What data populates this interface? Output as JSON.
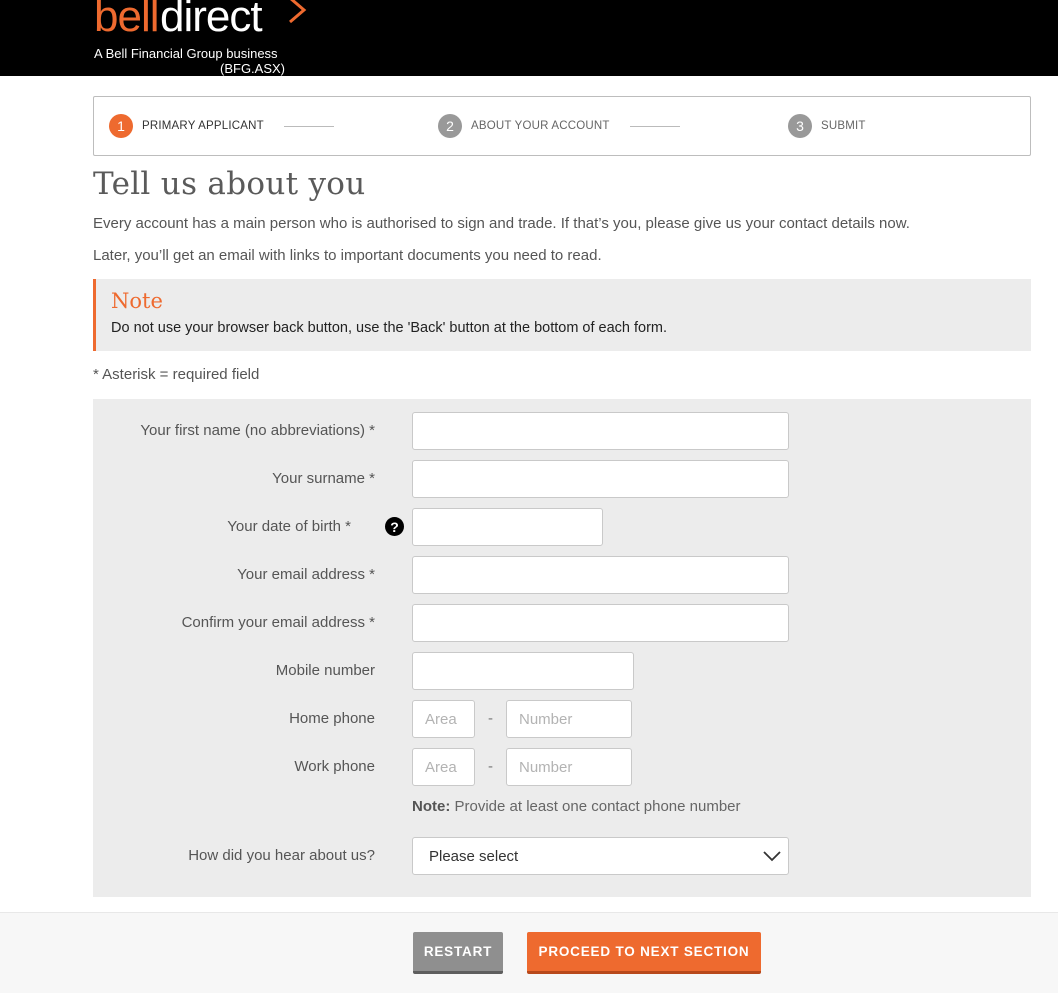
{
  "brand": {
    "logo_bell": "bell",
    "logo_direct": "direct",
    "tagline": "A Bell Financial Group business",
    "ticker": "(BFG.ASX)",
    "accent_color": "#ee6a2f"
  },
  "stepper": {
    "steps": [
      {
        "number": "1",
        "label": "PRIMARY APPLICANT",
        "active": true
      },
      {
        "number": "2",
        "label": "ABOUT YOUR ACCOUNT",
        "active": false
      },
      {
        "number": "3",
        "label": "SUBMIT",
        "active": false
      }
    ]
  },
  "page": {
    "title": "Tell us about you",
    "intro1": "Every account has a main person who is authorised to sign and trade. If that’s you, please give us your contact details now.",
    "intro2": "Later, you’ll get an email with links to important documents you need to read."
  },
  "note": {
    "title": "Note",
    "text": "Do not use your browser back button, use the 'Back' button at the bottom of each form."
  },
  "required_hint": "* Asterisk = required field",
  "form": {
    "first_name": {
      "label": "Your first name (no abbreviations) *",
      "value": ""
    },
    "surname": {
      "label": "Your surname *",
      "value": ""
    },
    "dob": {
      "label": "Your date of birth *",
      "value": "",
      "help_icon": "question-circle-icon",
      "help_glyph": "?"
    },
    "email": {
      "label": "Your email address *",
      "value": ""
    },
    "confirm_email": {
      "label": "Confirm your email address *",
      "value": ""
    },
    "mobile": {
      "label": "Mobile number",
      "value": ""
    },
    "home_phone": {
      "label": "Home phone",
      "area_placeholder": "Area",
      "number_placeholder": "Number",
      "separator": "-"
    },
    "work_phone": {
      "label": "Work phone",
      "area_placeholder": "Area",
      "number_placeholder": "Number",
      "separator": "-"
    },
    "phone_note_bold": "Note:",
    "phone_note_text": " Provide at least one contact phone number",
    "hear_about": {
      "label": "How did you hear about us?",
      "selected": "Please select",
      "icon": "chevron-down-icon"
    }
  },
  "footer": {
    "restart_label": "RESTART",
    "proceed_label": "PROCEED TO NEXT SECTION"
  }
}
